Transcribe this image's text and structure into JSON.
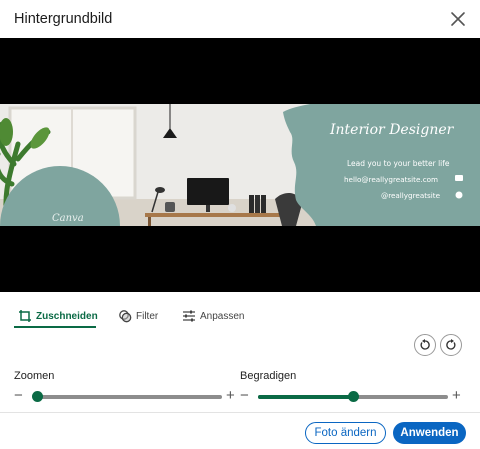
{
  "dialog": {
    "title": "Hintergrundbild"
  },
  "banner": {
    "heading": "Interior Designer",
    "tagline": "Lead you to your better life",
    "email": "hello@reallygreatsite.com",
    "handle": "@reallygreatsite",
    "logo_text": "Canva",
    "colors": {
      "teal": "#7fa59f",
      "background": "#000000"
    }
  },
  "tabs": [
    {
      "label": "Zuschneiden",
      "icon": "crop-icon",
      "active": true
    },
    {
      "label": "Filter",
      "icon": "filter-icon",
      "active": false
    },
    {
      "label": "Anpassen",
      "icon": "sliders-icon",
      "active": false
    }
  ],
  "sliders": {
    "zoom": {
      "label": "Zoomen",
      "value_fraction": 0.0
    },
    "straighten": {
      "label": "Begradigen",
      "value_fraction": 0.5
    }
  },
  "buttons": {
    "change_photo": "Foto ändern",
    "apply": "Anwenden"
  },
  "colors": {
    "accent": "#0a6a45",
    "link_blue": "#0a66c2"
  }
}
